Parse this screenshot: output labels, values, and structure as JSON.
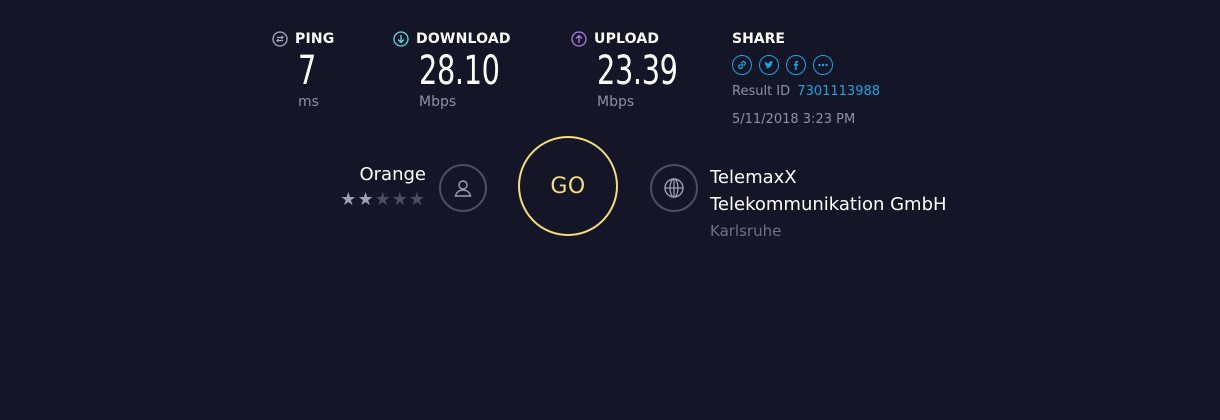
{
  "metrics": {
    "ping": {
      "label": "PING",
      "value": "7",
      "unit": "ms",
      "icon": "ping-icon",
      "color": "#a9abbd"
    },
    "download": {
      "label": "DOWNLOAD",
      "value": "28.10",
      "unit": "Mbps",
      "icon": "download-arrow-icon",
      "color": "#5be0e8"
    },
    "upload": {
      "label": "UPLOAD",
      "value": "23.39",
      "unit": "Mbps",
      "icon": "upload-arrow-icon",
      "color": "#b677e8"
    }
  },
  "share": {
    "label": "SHARE",
    "icons": [
      "link-icon",
      "twitter-icon",
      "facebook-icon",
      "more-icon"
    ],
    "result_label": "Result ID",
    "result_id": "7301113988",
    "date": "5/11/2018 3:23 PM"
  },
  "isp": {
    "name": "Orange",
    "rating": 2,
    "rating_max": 5,
    "icon": "user-icon"
  },
  "go_button": {
    "label": "GO",
    "color": "#f3dc7e"
  },
  "server": {
    "line1": "TelemaxX",
    "line2": "Telekommunikation GmbH",
    "location": "Karlsruhe",
    "icon": "globe-icon"
  },
  "colors": {
    "background": "#141526",
    "accent_link": "#1fa3e0",
    "muted_text": "#8d8fa3"
  }
}
